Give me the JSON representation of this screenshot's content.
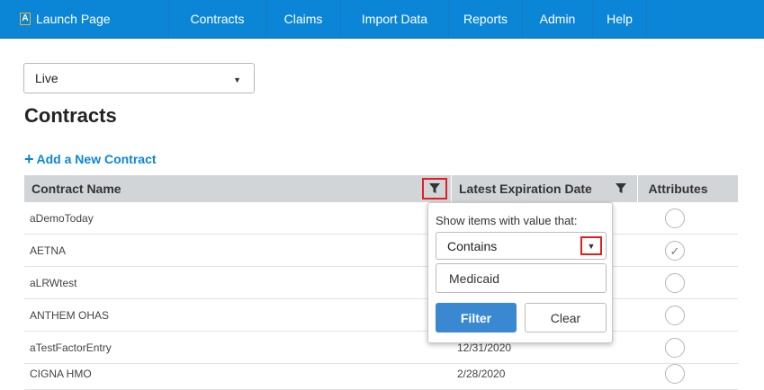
{
  "topnav": {
    "launch_logo": "A",
    "launch_label": "Launch Page",
    "items": [
      {
        "label": "Contracts"
      },
      {
        "label": "Claims"
      },
      {
        "label": "Import Data"
      },
      {
        "label": "Reports"
      },
      {
        "label": "Admin"
      },
      {
        "label": "Help"
      }
    ]
  },
  "environment_select": {
    "value": "Live"
  },
  "page": {
    "title": "Contracts"
  },
  "actions": {
    "add_contract_label": "Add a New Contract"
  },
  "grid": {
    "columns": [
      "Contract Name",
      "Latest Expiration Date",
      "Attributes"
    ],
    "rows": [
      {
        "name": "aDemoToday",
        "date": "",
        "attribute_checked": false
      },
      {
        "name": "AETNA",
        "date": "",
        "attribute_checked": true
      },
      {
        "name": "aLRWtest",
        "date": "",
        "attribute_checked": false
      },
      {
        "name": "ANTHEM OHAS",
        "date": "",
        "attribute_checked": false
      },
      {
        "name": "aTestFactorEntry",
        "date": "12/31/2020",
        "attribute_checked": false
      },
      {
        "name": "CIGNA HMO",
        "date": "2/28/2020",
        "attribute_checked": false
      }
    ]
  },
  "filter_popup": {
    "label": "Show items with value that:",
    "operator": "Contains",
    "value": "Medicaid",
    "filter_button": "Filter",
    "clear_button": "Clear"
  },
  "colors": {
    "nav_background": "#0b86d6",
    "accent": "#0b86d6",
    "highlight": "#e02020",
    "header_background": "#d2d5d8",
    "filter_button": "#3a87d2"
  }
}
